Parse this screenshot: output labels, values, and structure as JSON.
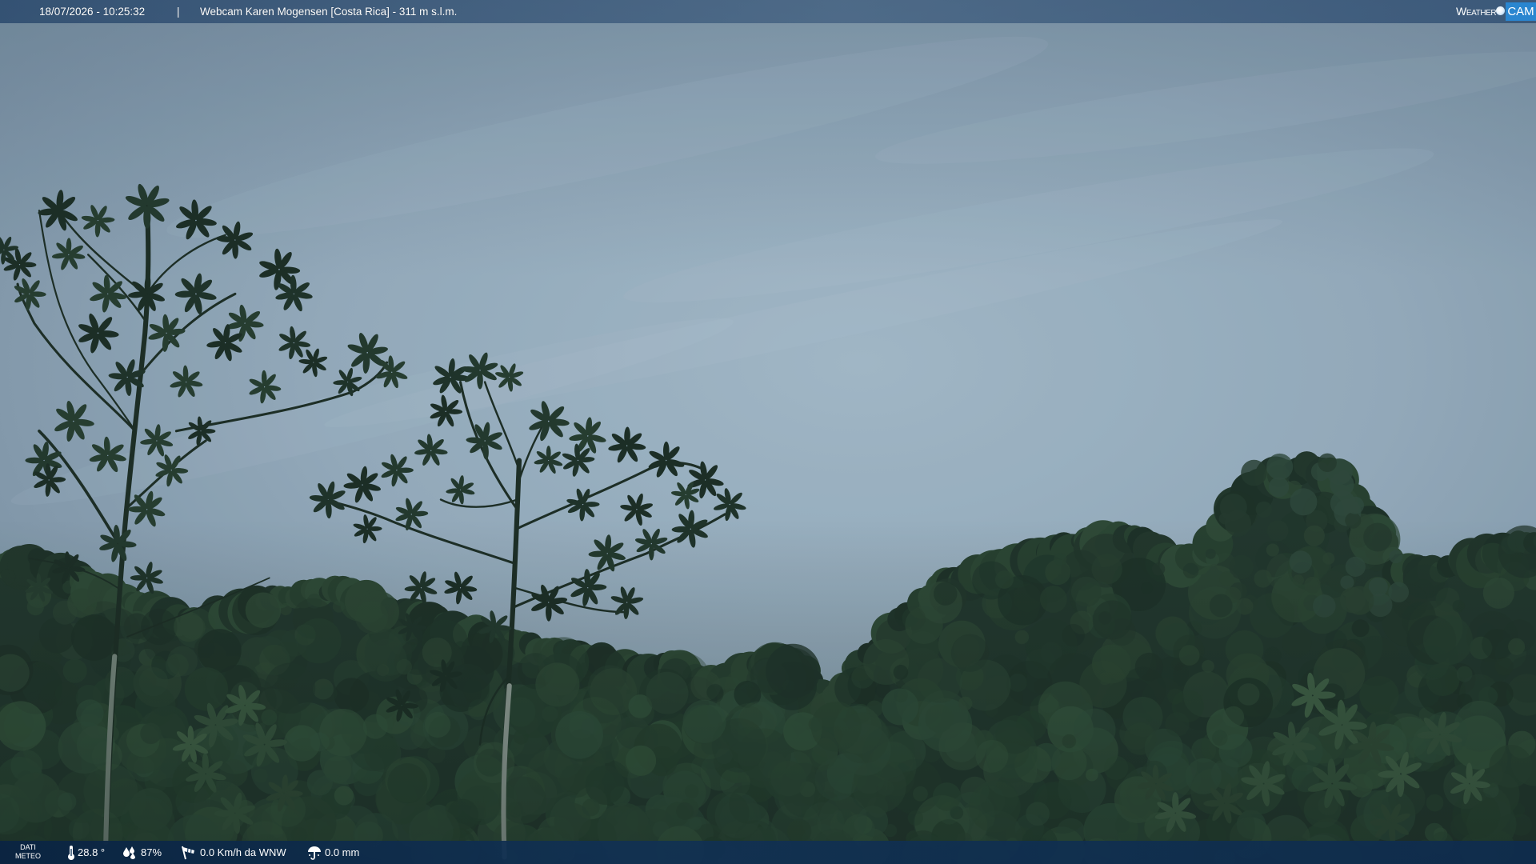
{
  "header": {
    "datetime": "18/07/2026 - 10:25:32",
    "separator": "|",
    "title": "Webcam Karen Mogensen [Costa Rica] - 311 m s.l.m."
  },
  "logo": {
    "word": "Weather",
    "badge": "CAM",
    "icon": "lens-circle-icon"
  },
  "weather_bar": {
    "button_line1": "DATI",
    "button_line2": "METEO",
    "temperature": "28.8 °",
    "humidity": "87%",
    "wind": "0.0 Km/h da WNW",
    "rain": "0.0 mm",
    "icons": {
      "temperature": "thermometer-icon",
      "humidity": "humidity-icon",
      "wind": "wind-icon",
      "rain": "rain-gauge-icon"
    }
  },
  "colors": {
    "header_bar": "#2f5478",
    "weather_bar": "#0c2846",
    "logo_badge": "#2a86d0",
    "text": "#ffffff",
    "sky": "#99afbf",
    "forest": "#22362a"
  }
}
